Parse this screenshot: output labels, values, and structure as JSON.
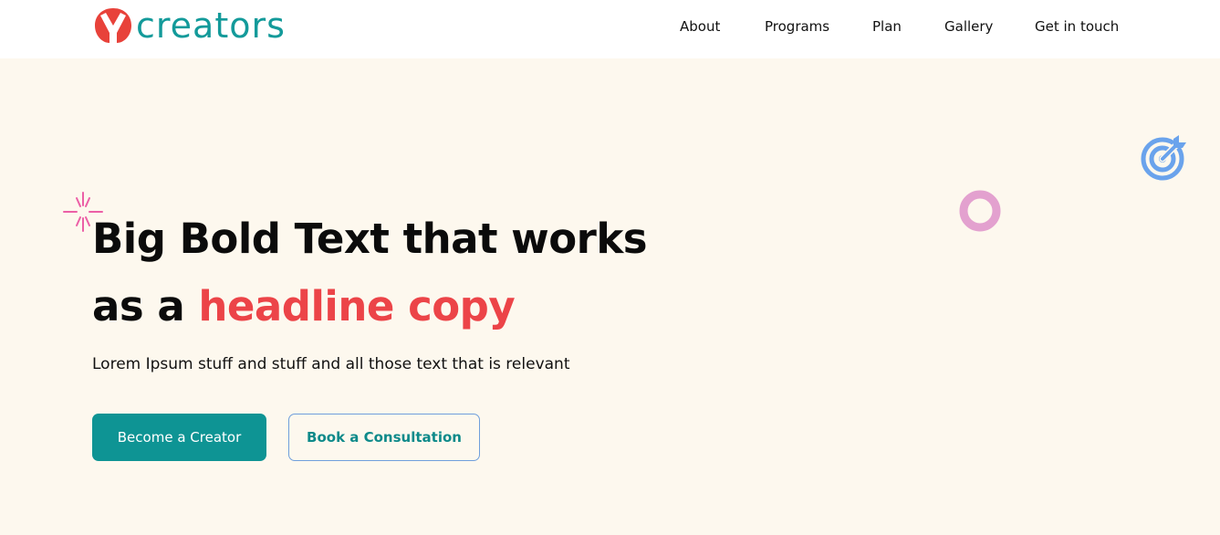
{
  "header": {
    "logo": {
      "text": "creators",
      "mark": "y-mark-icon",
      "colors": {
        "mark": "#e8423a",
        "text": "#139a9a"
      }
    },
    "nav": [
      {
        "label": "About"
      },
      {
        "label": "Programs"
      },
      {
        "label": "Plan"
      },
      {
        "label": "Gallery"
      },
      {
        "label": "Get in touch"
      }
    ]
  },
  "hero": {
    "headline_line1": "Big Bold Text that works",
    "headline_line2_prefix": "as a ",
    "headline_line2_accent": "headline copy",
    "subtext": "Lorem Ipsum stuff and stuff and all those text that is relevant",
    "primary_button": "Become a Creator",
    "secondary_button": "Book a Consultation",
    "decorations": [
      "sparkle-icon",
      "ring-icon",
      "target-icon"
    ]
  },
  "colors": {
    "hero_bg": "#fdf8ee",
    "accent_red": "#ec4448",
    "teal": "#0e9494",
    "sparkle": "#ec5fa6",
    "ring": "#e3a1cf",
    "target": "#6aa3ec"
  }
}
